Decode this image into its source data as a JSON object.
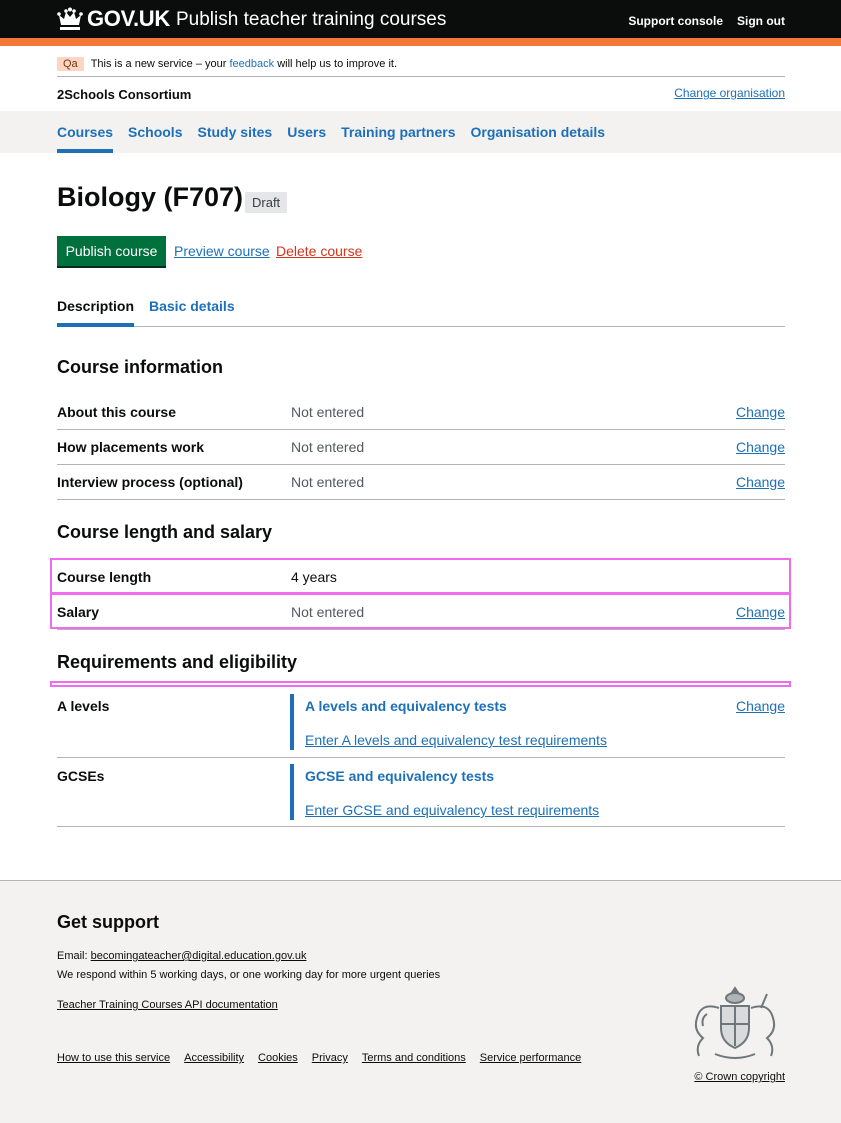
{
  "header": {
    "logo_text": "GOV.UK",
    "service_name": "Publish teacher training courses",
    "nav": [
      "Support console",
      "Sign out"
    ]
  },
  "phase_banner": {
    "tag": "Qa",
    "text_before": "This is a new service – your",
    "link": "feedback",
    "text_after": "will help us to improve it."
  },
  "organisation": {
    "name": "2Schools Consortium",
    "change_link": "Change organisation"
  },
  "subnav": {
    "items": [
      "Courses",
      "Schools",
      "Study sites",
      "Users",
      "Training partners",
      "Organisation details"
    ]
  },
  "course": {
    "title": "Biology (F707)",
    "status": "Draft"
  },
  "actions": {
    "publish": "Publish course",
    "preview": "Preview course",
    "delete": "Delete course"
  },
  "tabs": {
    "description": "Description",
    "basic_details": "Basic details"
  },
  "course_information": {
    "heading": "Course information",
    "rows": [
      {
        "key": "About this course",
        "value": "Not entered",
        "action": "Change"
      },
      {
        "key": "How placements work",
        "value": "Not entered",
        "action": "Change"
      },
      {
        "key": "Interview process (optional)",
        "value": "Not entered",
        "action": "Change"
      }
    ]
  },
  "course_length_salary": {
    "heading": "Course length and salary",
    "rows": [
      {
        "key": "Course length",
        "value": "4 years"
      },
      {
        "key": "Salary",
        "value": "Not entered",
        "action": "Change"
      }
    ]
  },
  "requirements": {
    "heading": "Requirements and eligibility",
    "rows": [
      {
        "key": "A levels",
        "inset_title": "A levels and equivalency tests",
        "inset_link": "Enter A levels and equivalency test requirements",
        "action": "Change"
      },
      {
        "key": "GCSEs",
        "inset_title": "GCSE and equivalency tests",
        "inset_link": "Enter GCSE and equivalency test requirements"
      }
    ]
  },
  "footer": {
    "heading": "Get support",
    "email_label": "Email:",
    "email": "becomingateacher@digital.education.gov.uk",
    "respond": "We respond within 5 working days, or one working day for more urgent queries",
    "api_link": "Teacher Training Courses API documentation",
    "links": [
      "How to use this service",
      "Accessibility",
      "Cookies",
      "Privacy",
      "Terms and conditions",
      "Service performance"
    ],
    "copyright": "© Crown copyright"
  },
  "colors": {
    "header_bg": "#0b0c0c",
    "accent_bar": "#f47738",
    "link": "#1d70b8",
    "publish_button": "#00703c",
    "delete_link": "#d4351c",
    "highlight": "#f06bf0"
  }
}
